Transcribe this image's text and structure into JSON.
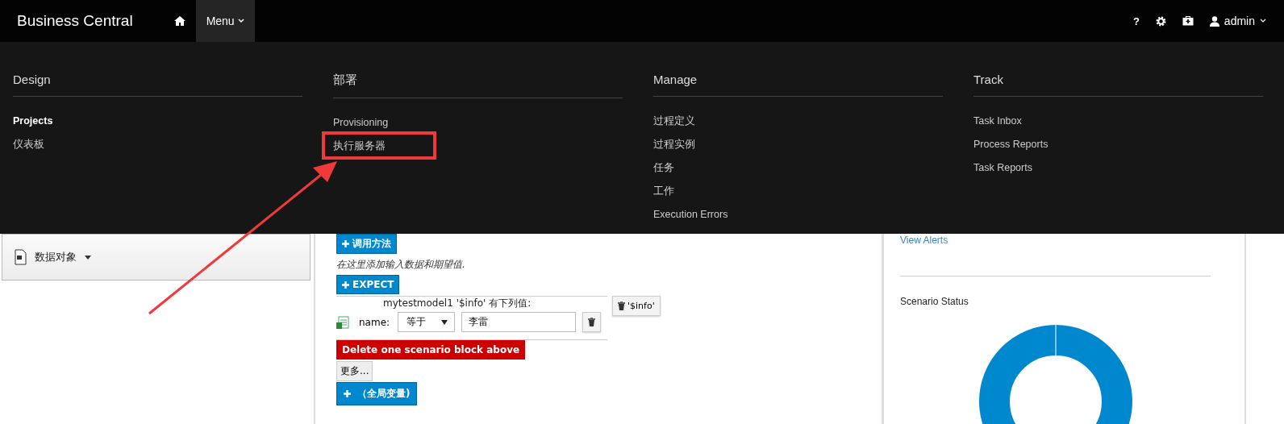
{
  "navbar": {
    "brand": "Business Central",
    "menu_label": "Menu",
    "help_label": "?",
    "user": "admin"
  },
  "menu": {
    "columns": [
      {
        "title": "Design",
        "items": [
          {
            "label": "Projects",
            "selected": true,
            "highlighted": false
          },
          {
            "label": "仪表板",
            "selected": false,
            "highlighted": false
          }
        ]
      },
      {
        "title": "部署",
        "items": [
          {
            "label": "Provisioning",
            "selected": false,
            "highlighted": false
          },
          {
            "label": "执行服务器",
            "selected": false,
            "highlighted": true
          }
        ]
      },
      {
        "title": "Manage",
        "items": [
          {
            "label": "过程定义",
            "selected": false,
            "highlighted": false
          },
          {
            "label": "过程实例",
            "selected": false,
            "highlighted": false
          },
          {
            "label": "任务",
            "selected": false,
            "highlighted": false
          },
          {
            "label": "工作",
            "selected": false,
            "highlighted": false
          },
          {
            "label": "Execution Errors",
            "selected": false,
            "highlighted": false
          }
        ]
      },
      {
        "title": "Track",
        "items": [
          {
            "label": "Task Inbox",
            "selected": false,
            "highlighted": false
          },
          {
            "label": "Process Reports",
            "selected": false,
            "highlighted": false
          },
          {
            "label": "Task Reports",
            "selected": false,
            "highlighted": false
          }
        ]
      }
    ]
  },
  "sidebar": {
    "items": [
      {
        "label": "数据对象"
      }
    ]
  },
  "editor": {
    "call_button": "调用方法",
    "hint": "在这里添加输入数据和期望值.",
    "expect_button": "EXPECT",
    "fact_title": "mytestmodel1 '$info' 有下列值:",
    "field": {
      "label": "name:",
      "operator": "等于",
      "value": "李雷"
    },
    "remove_fact_label": "'$info'",
    "delete_button": "Delete one scenario block above",
    "more_button": "更多...",
    "global_button": "（全局变量)"
  },
  "side_panel": {
    "link": "View Alerts",
    "section_title": "Scenario Status"
  }
}
